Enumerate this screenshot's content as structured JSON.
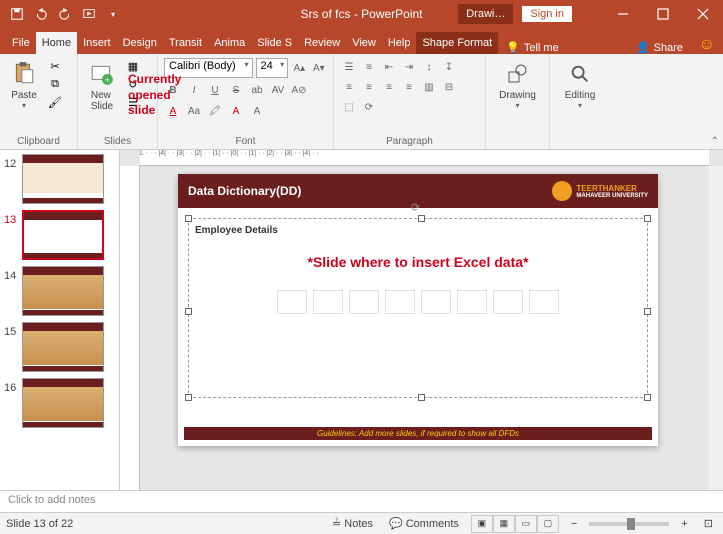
{
  "titlebar": {
    "title": "Srs of fcs - PowerPoint",
    "drawing": "Drawi…",
    "sign_in": "Sign in"
  },
  "tabs": {
    "file": "File",
    "home": "Home",
    "insert": "Insert",
    "design": "Design",
    "transitions": "Transit",
    "animations": "Anima",
    "slideshow": "Slide S",
    "review": "Review",
    "view": "View",
    "help": "Help",
    "shapeformat": "Shape Format",
    "tellme": "Tell me",
    "share": "Share"
  },
  "ribbon": {
    "clipboard": "Clipboard",
    "paste": "Paste",
    "slides": "Slides",
    "new_slide": "New\nSlide",
    "font": "Font",
    "font_family": "Calibri (Body)",
    "font_size": "24",
    "paragraph": "Paragraph",
    "drawing": "Drawing",
    "editing": "Editing"
  },
  "thumbs": {
    "n12": "12",
    "n13": "13",
    "n14": "14",
    "n15": "15",
    "n16": "16"
  },
  "annotation": "Currently\nopened\nslide",
  "slide": {
    "title": "Data Dictionary(DD)",
    "uni1": "TEERTHANKER",
    "uni2": "MAHAVEER UNIVERSITY",
    "emp": "Employee Details",
    "hint": "*Slide where to insert Excel data*",
    "footer": "Guidelines: Add more slides, if required to show all DFDs"
  },
  "notes": "Click to add notes",
  "statusbar": {
    "slide_pos": "Slide 13 of 22",
    "notes": "Notes",
    "comments": "Comments"
  }
}
